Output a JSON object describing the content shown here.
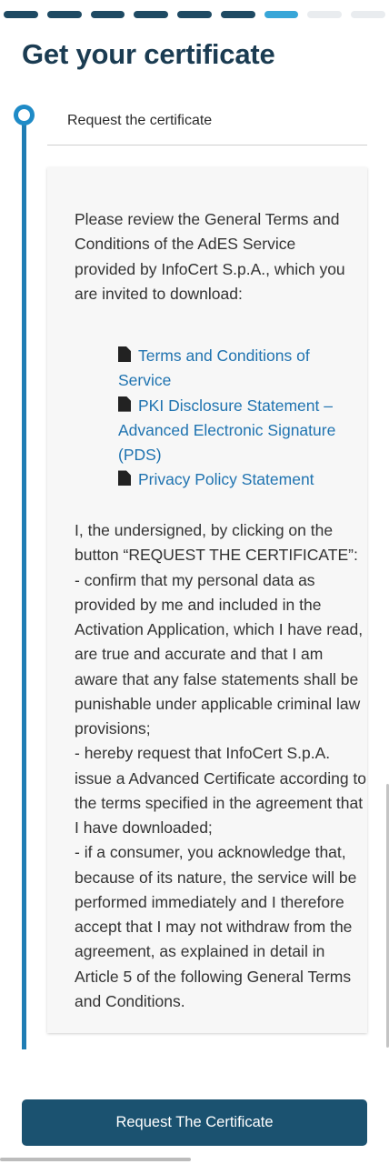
{
  "progress": {
    "total_steps": 9,
    "current_step": 7,
    "colors": {
      "done": "#1e4a63",
      "active": "#38a6d8",
      "todo": "#e9ecef"
    }
  },
  "page_title": "Get your certificate",
  "step": {
    "label": "Request the certificate",
    "indicator_icon": "ring-step-icon"
  },
  "card": {
    "intro": "Please review the General Terms and Conditions of the AdES Service provided by InfoCert S.p.A., which you are invited to download:",
    "documents": [
      {
        "icon": "document-icon",
        "label": "Terms and Conditions of Service"
      },
      {
        "icon": "document-icon",
        "label": "PKI Disclosure Statement – Advanced Electronic Signature (PDS)"
      },
      {
        "icon": "document-icon",
        "label": "Privacy Policy Statement"
      }
    ],
    "declaration": "I, the undersigned, by clicking on the button “REQUEST THE CERTIFICATE”:\n- confirm that my personal data as provided by me and included in the Activation Application, which I have read, are true and accurate and that I am aware that any false statements shall be punishable under applicable criminal law provisions;\n- hereby request that InfoCert S.p.A. issue a Advanced Certificate according to the terms specified in the agreement that I have downloaded;\n- if a consumer, you acknowledge that, because of its nature, the service will be performed immediately and I therefore accept that I may not withdraw from the agreement, as explained in detail in Article 5 of the following General Terms and Conditions."
  },
  "primary_button": {
    "label": "Request The Certificate",
    "color": "#1b5270"
  },
  "accent_color": "#1f7db4"
}
